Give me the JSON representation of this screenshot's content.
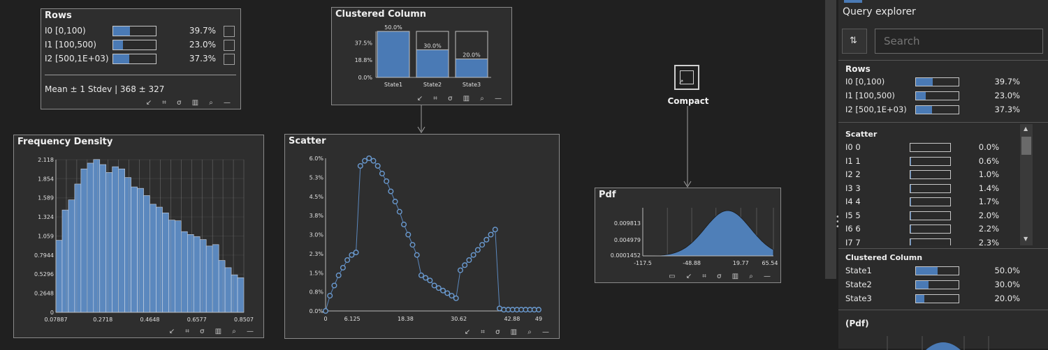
{
  "rows_panel": {
    "title": "Rows",
    "items": [
      {
        "label": "I0 [0,100)",
        "fraction": 0.397,
        "pct": "39.7%"
      },
      {
        "label": "I1 [100,500)",
        "fraction": 0.23,
        "pct": "23.0%"
      },
      {
        "label": "I2 [500,1E+03)",
        "fraction": 0.373,
        "pct": "37.3%"
      }
    ],
    "summary": "Mean ± 1 Stdev  |  368 ± 327"
  },
  "clustered_panel": {
    "title": "Clustered Column"
  },
  "freq_panel": {
    "title": "Frequency Density"
  },
  "scatter_panel": {
    "title": "Scatter"
  },
  "pdf_panel": {
    "title": "Pdf"
  },
  "compact_node": {
    "label": "Compact"
  },
  "toolbar_glyphs": "↙ ⌗ σ ▥ ⌕ —",
  "toolbar_glyphs_pdf": "▭ ↙ ⌗ σ ▥ ⌕ —",
  "explorer": {
    "title": "Query explorer",
    "search_placeholder": "Search",
    "rows_header": "Rows",
    "rows": [
      {
        "label": "I0 [0,100)",
        "fraction": 0.397,
        "pct": "39.7%"
      },
      {
        "label": "I1 [100,500)",
        "fraction": 0.23,
        "pct": "23.0%"
      },
      {
        "label": "I2 [500,1E+03)",
        "fraction": 0.373,
        "pct": "37.3%"
      }
    ],
    "scatter_header": "Scatter",
    "scatter_rows": [
      {
        "label": "I0 0",
        "fraction": 0.0,
        "pct": "0.0%"
      },
      {
        "label": "I1 1",
        "fraction": 0.006,
        "pct": "0.6%"
      },
      {
        "label": "I2 2",
        "fraction": 0.01,
        "pct": "1.0%"
      },
      {
        "label": "I3 3",
        "fraction": 0.014,
        "pct": "1.4%"
      },
      {
        "label": "I4 4",
        "fraction": 0.017,
        "pct": "1.7%"
      },
      {
        "label": "I5 5",
        "fraction": 0.02,
        "pct": "2.0%"
      },
      {
        "label": "I6 6",
        "fraction": 0.022,
        "pct": "2.2%"
      },
      {
        "label": "I7 7",
        "fraction": 0.023,
        "pct": "2.3%"
      }
    ],
    "clustered_header": "Clustered Column",
    "clustered_rows": [
      {
        "label": "State1",
        "fraction": 0.5,
        "pct": "50.0%"
      },
      {
        "label": "State2",
        "fraction": 0.3,
        "pct": "30.0%"
      },
      {
        "label": "State3",
        "fraction": 0.2,
        "pct": "20.0%"
      }
    ],
    "pdf_header": "(Pdf)"
  },
  "chart_data": [
    {
      "type": "bar",
      "title": "Clustered Column",
      "categories": [
        "State1",
        "State2",
        "State3"
      ],
      "values": [
        50.0,
        30.0,
        20.0
      ],
      "data_labels": [
        "50.0%",
        "30.0%",
        "20.0%"
      ],
      "yticks": [
        "37.5%",
        "18.8%",
        "0.0%"
      ],
      "ylim": [
        0,
        50
      ]
    },
    {
      "type": "bar",
      "title": "Frequency Density",
      "values": [
        1.0,
        1.42,
        1.56,
        1.78,
        1.99,
        2.07,
        2.12,
        2.05,
        1.94,
        2.02,
        1.99,
        1.87,
        1.74,
        1.72,
        1.62,
        1.5,
        1.46,
        1.38,
        1.28,
        1.27,
        1.12,
        1.08,
        1.05,
        1.01,
        0.92,
        0.94,
        0.72,
        0.62,
        0.52,
        0.48
      ],
      "yticks": [
        "2.118",
        "1.854",
        "1.589",
        "1.324",
        "1.059",
        "0.7944",
        "0.5296",
        "0.2648",
        "0"
      ],
      "xticks": [
        "0.07887",
        "0.2718",
        "0.4648",
        "0.6577",
        "0.8507"
      ],
      "ylim": [
        0,
        2.118
      ],
      "xlim": [
        0.07887,
        0.8507
      ]
    },
    {
      "type": "scatter",
      "title": "Scatter",
      "x": [
        0,
        1,
        2,
        3,
        4,
        5,
        6,
        7,
        8,
        9,
        10,
        11,
        12,
        13,
        14,
        15,
        16,
        17,
        18,
        19,
        20,
        21,
        22,
        23,
        24,
        25,
        26,
        27,
        28,
        29,
        30,
        31,
        32,
        33,
        34,
        35,
        36,
        37,
        38,
        39,
        40,
        41,
        42,
        43,
        44,
        45,
        46,
        47,
        48,
        49
      ],
      "values": [
        0.0,
        0.6,
        1.0,
        1.4,
        1.7,
        2.0,
        2.2,
        2.3,
        5.7,
        5.9,
        6.0,
        5.9,
        5.7,
        5.4,
        5.1,
        4.7,
        4.3,
        3.9,
        3.4,
        3.0,
        2.6,
        2.2,
        1.4,
        1.3,
        1.2,
        1.0,
        0.9,
        0.8,
        0.7,
        0.6,
        0.5,
        1.6,
        1.8,
        2.0,
        2.2,
        2.4,
        2.6,
        2.8,
        3.0,
        3.2,
        0.1,
        0.05,
        0.05,
        0.05,
        0.05,
        0.05,
        0.05,
        0.05,
        0.05,
        0.05
      ],
      "yticks": [
        "6.0%",
        "5.3%",
        "4.5%",
        "3.8%",
        "3.0%",
        "2.3%",
        "1.5%",
        "0.8%",
        "0.0%"
      ],
      "xticks": [
        "0",
        "6.125",
        "18.38",
        "30.62",
        "42.88",
        "49"
      ],
      "xlim": [
        0,
        49
      ],
      "ylim": [
        0,
        6.0
      ]
    },
    {
      "type": "area",
      "title": "Pdf",
      "distribution": "normal",
      "mean": 1.5,
      "yticks": [
        "0.009813",
        "0.004979",
        "0.0001452"
      ],
      "xticks": [
        "-117.5",
        "-48.88",
        "19.77",
        "65.54"
      ],
      "xlim": [
        -117.5,
        65.54
      ]
    }
  ],
  "colors": {
    "accent": "#4a7ab5",
    "background": "#202020",
    "panel": "#2e2e2e",
    "border": "#8a8a8a"
  }
}
